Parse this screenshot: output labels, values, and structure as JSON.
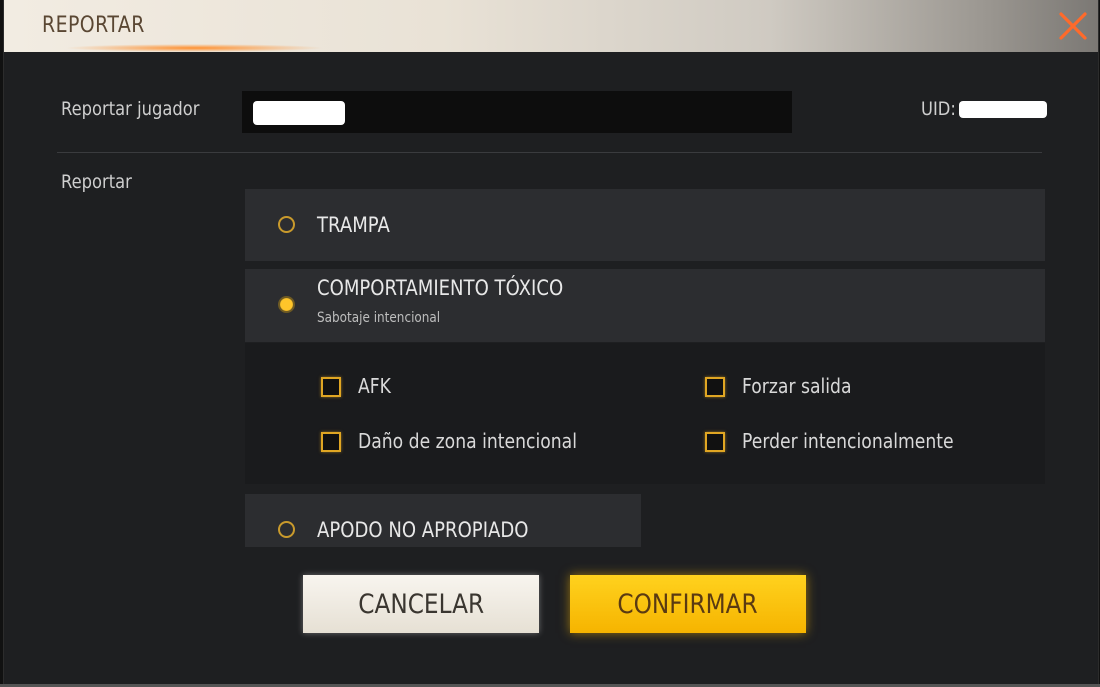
{
  "dialog": {
    "title": "REPORTAR"
  },
  "player": {
    "label": "Reportar jugador",
    "uid_label": "UID:"
  },
  "report": {
    "label": "Reportar",
    "options": [
      {
        "label": "TRAMPA",
        "selected": false
      },
      {
        "label": "COMPORTAMIENTO TÓXICO",
        "sublabel": "Sabotaje intencional",
        "selected": true
      },
      {
        "label": "APODO NO APROPIADO",
        "selected": false
      }
    ],
    "sub_options": [
      {
        "label": "AFK",
        "checked": false
      },
      {
        "label": "Forzar salida",
        "checked": false
      },
      {
        "label": "Daño de zona intencional",
        "checked": false
      },
      {
        "label": "Perder intencionalmente",
        "checked": false
      }
    ]
  },
  "buttons": {
    "cancel": "CANCELAR",
    "confirm": "CONFIRMAR"
  },
  "colors": {
    "accent": "#ffc52a",
    "close": "#ff6a2a",
    "panel": "#2c2d30"
  },
  "icons": {
    "close": "close-icon"
  }
}
